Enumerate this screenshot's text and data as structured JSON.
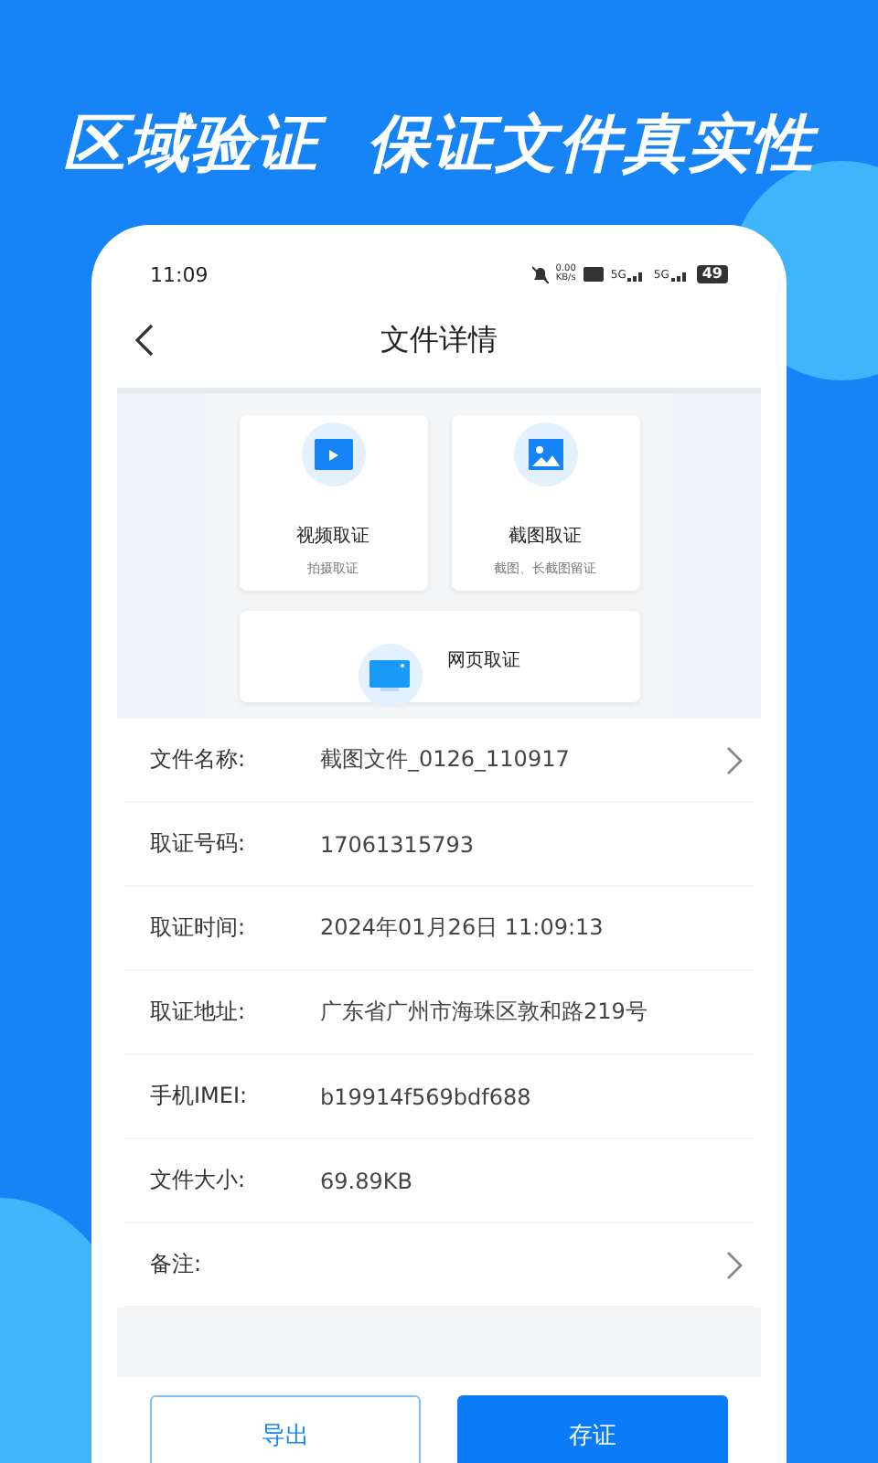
{
  "headline": "区域验证  保证文件真实性",
  "status_bar": {
    "time": "11:09",
    "net_speed": [
      "0.00",
      "KB/s"
    ],
    "signals": [
      "5G",
      "5G"
    ],
    "battery": "49"
  },
  "nav": {
    "title": "文件详情"
  },
  "preview": {
    "cards": [
      {
        "kind": "video",
        "title": "视频取证",
        "subtitle": "拍摄取证"
      },
      {
        "kind": "image",
        "title": "截图取证",
        "subtitle": "截图、长截图留证"
      },
      {
        "kind": "web",
        "title": "网页取证"
      }
    ]
  },
  "details": [
    {
      "label": "文件名称:",
      "value": "截图文件_0126_110917",
      "link": true
    },
    {
      "label": "取证号码:",
      "value": "17061315793",
      "link": false
    },
    {
      "label": "取证时间:",
      "value": "2024年01月26日 11:09:13",
      "link": false
    },
    {
      "label": "取证地址:",
      "value": "广东省广州市海珠区敦和路219号",
      "link": false
    },
    {
      "label": "手机IMEI:",
      "value": "b19914f569bdf688",
      "link": false
    },
    {
      "label": "文件大小:",
      "value": "69.89KB",
      "link": false
    },
    {
      "label": "备注:",
      "link": true
    }
  ],
  "buttons": [
    {
      "label": "导出",
      "kind": "outline"
    },
    {
      "label": "存证",
      "kind": "primary"
    }
  ]
}
